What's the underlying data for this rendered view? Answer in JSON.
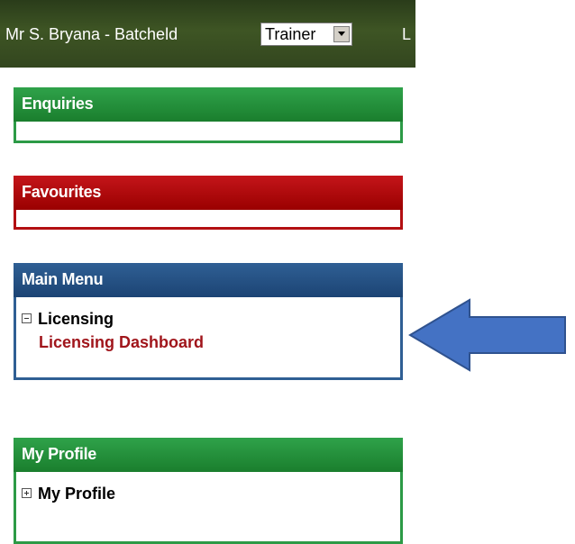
{
  "topbar": {
    "user_name": "Mr S. Bryana - Batcheld",
    "role_selected": "Trainer",
    "extra_text": "L"
  },
  "panels": {
    "enquiries": {
      "title": "Enquiries"
    },
    "favourites": {
      "title": "Favourites"
    },
    "main_menu": {
      "title": "Main Menu",
      "node": "Licensing",
      "link": "Licensing Dashboard"
    },
    "my_profile": {
      "title": "My Profile",
      "node": "My Profile"
    }
  },
  "colors": {
    "green": "#2c9a46",
    "red": "#b30f12",
    "blue": "#2f5f94",
    "arrow": "#4472c4"
  },
  "icons": [
    "collapse-icon",
    "expand-icon",
    "dropdown-arrow-icon",
    "pointer-arrow-icon"
  ]
}
